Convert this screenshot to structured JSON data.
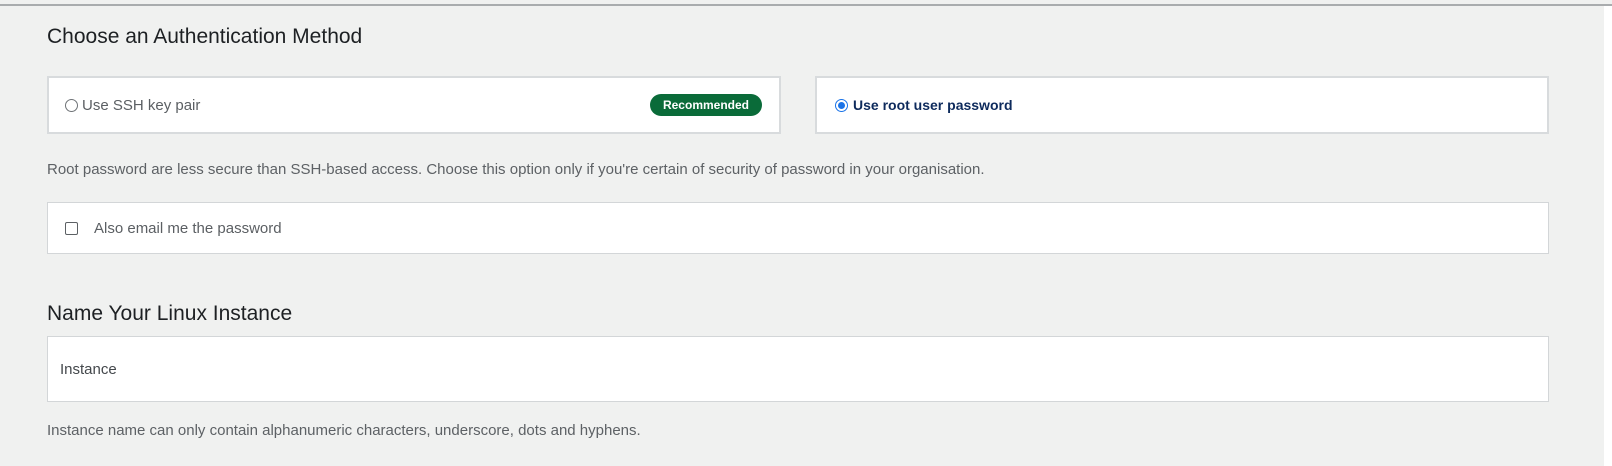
{
  "auth": {
    "title": "Choose an Authentication Method",
    "options": [
      {
        "label": "Use SSH key pair",
        "badge": "Recommended",
        "selected": false
      },
      {
        "label": "Use root user password",
        "selected": true
      }
    ],
    "helper": "Root password are less secure than SSH-based access. Choose this option only if you're certain of security of password in your organisation.",
    "email_checkbox": {
      "label": "Also email me the password",
      "checked": false
    }
  },
  "instance": {
    "title": "Name Your Linux Instance",
    "input": {
      "value": "",
      "placeholder": "Instance"
    },
    "helper": "Instance name can only contain alphanumeric characters, underscore, dots and hyphens."
  },
  "colors": {
    "badge": "#0a6b39",
    "radio_selected": "#1a73e8",
    "selected_label": "#0d2a5c",
    "page_background": "#f0f1f0"
  }
}
